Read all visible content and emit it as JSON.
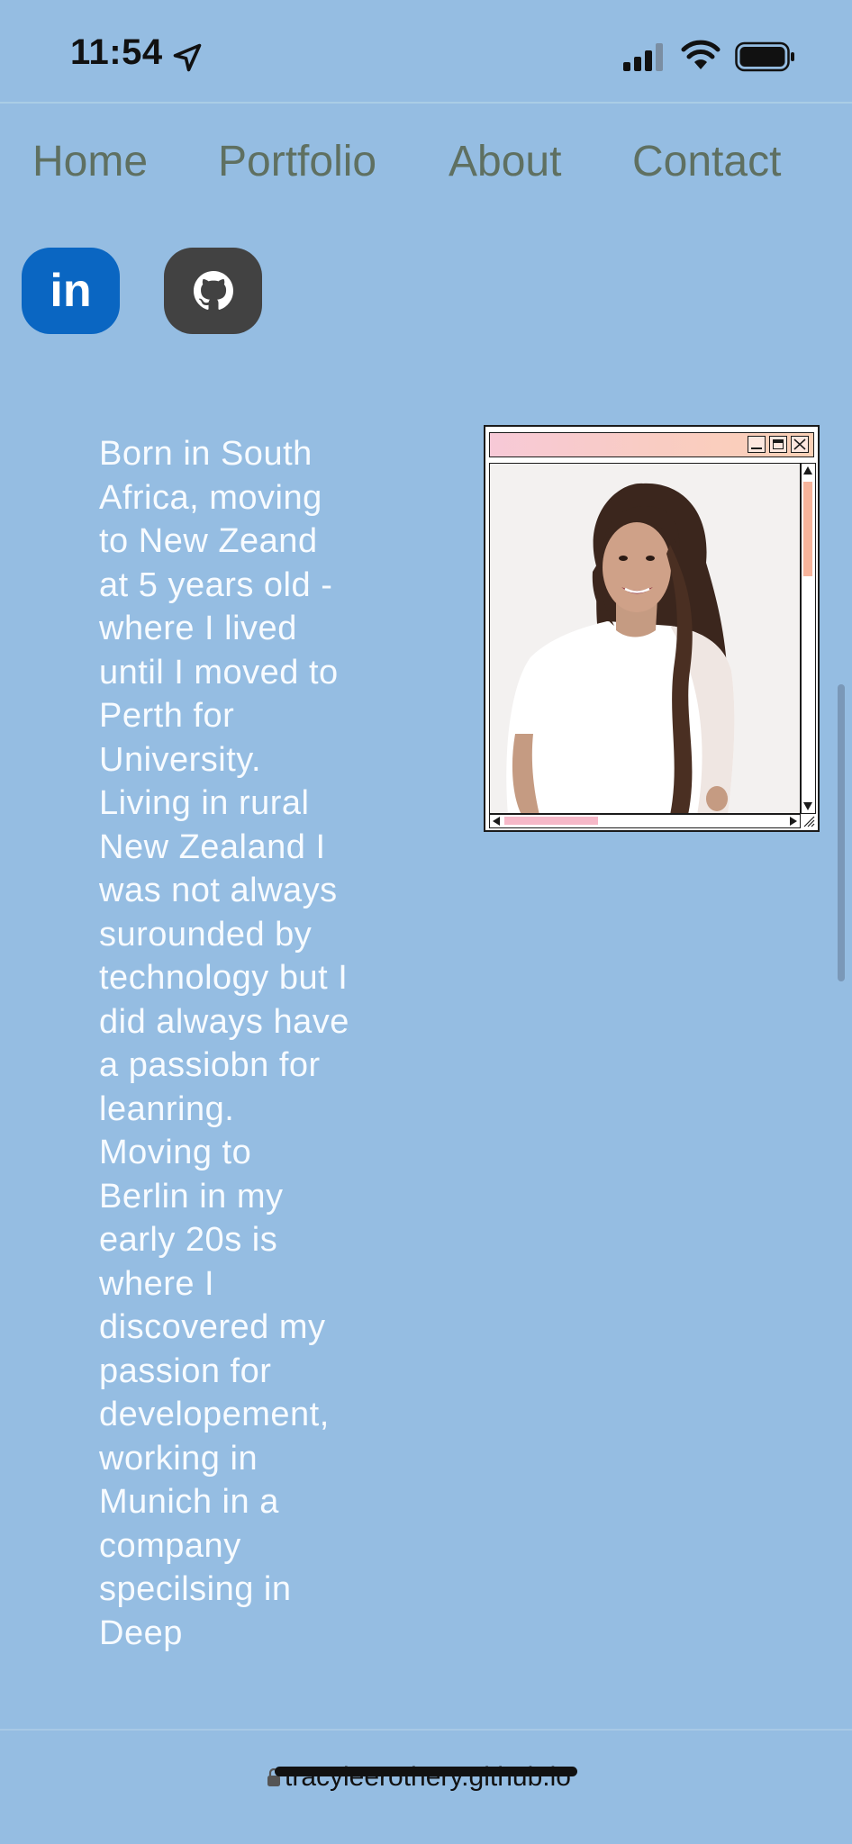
{
  "status_bar": {
    "time": "11:54",
    "icons": [
      "location-arrow-icon",
      "cellular-signal-icon",
      "wifi-icon",
      "battery-icon"
    ]
  },
  "nav": {
    "items": [
      {
        "label": "Home"
      },
      {
        "label": "Portfolio"
      },
      {
        "label": "About"
      },
      {
        "label": "Contact"
      }
    ]
  },
  "social": {
    "linkedin": {
      "label": "in",
      "icon": "linkedin-icon",
      "color": "#0a66c2"
    },
    "github": {
      "icon": "github-icon",
      "color": "#424242"
    }
  },
  "bio": {
    "text": "Born in South Africa, moving to New Zeand at 5 years old - where I lived until I moved to Perth for University. Living in rural New Zealand I was not always surounded by technology but I did always have a passiobn for leanring. Moving to Berlin in my early 20s is where I discovered my passion for developement, working in Munich in a company specilsing in Deep"
  },
  "photo_window": {
    "title_gradient": [
      "#f7c9d7",
      "#fbd0b6"
    ],
    "buttons": [
      "minimize-icon",
      "maximize-icon",
      "close-icon"
    ],
    "scroll_accent": "#f6b39a"
  },
  "browser": {
    "url": "tracyleerothery.github.io"
  },
  "colors": {
    "background": "#95bde2",
    "nav_text": "#5f7061",
    "bio_text": "#f7fbff"
  }
}
